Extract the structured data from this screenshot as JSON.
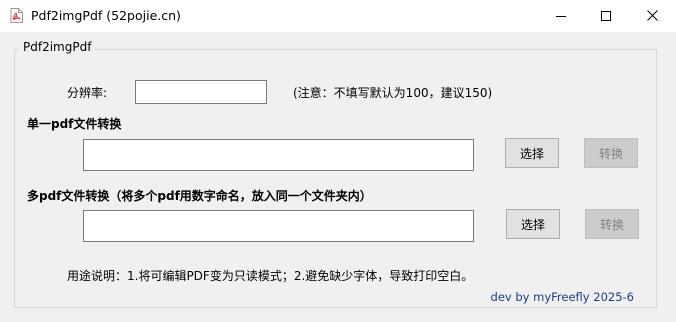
{
  "window": {
    "title": "Pdf2imgPdf (52pojie.cn)"
  },
  "group": {
    "legend": "Pdf2imgPdf"
  },
  "resolution": {
    "label": "分辨率:",
    "value": "",
    "note": "(注意：不填写默认为100，建议150)"
  },
  "single": {
    "heading": "单一pdf文件转换",
    "path_value": "",
    "select_label": "选择",
    "convert_label": "转换"
  },
  "multi": {
    "heading": "多pdf文件转换（将多个pdf用数字命名，放入同一个文件夹内）",
    "path_value": "",
    "select_label": "选择",
    "convert_label": "转换"
  },
  "usage": "用途说明：1.将可编辑PDF变为只读模式；2.避免缺少字体，导致打印空白。",
  "credit": "dev by myFreefly 2025-6",
  "icons": {
    "app": "pdf-file-icon",
    "minimize": "minimize-icon",
    "maximize": "maximize-icon",
    "close": "close-icon"
  },
  "colors": {
    "window_bg": "#f0f0f0",
    "titlebar_bg": "#ffffff",
    "credit_text": "#1e3a8a",
    "disabled_text": "#838383"
  }
}
